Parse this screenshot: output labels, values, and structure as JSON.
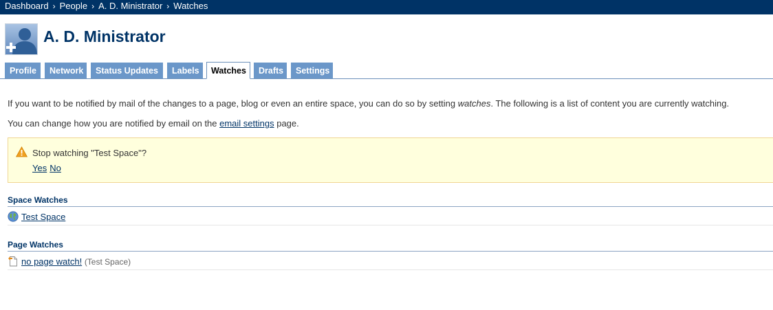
{
  "breadcrumb": {
    "items": [
      "Dashboard",
      "People",
      "A. D. Ministrator",
      "Watches"
    ],
    "separator": "›"
  },
  "header": {
    "title": "A. D. Ministrator",
    "avatar_icon": "user-avatar-icon"
  },
  "tabs": [
    {
      "label": "Profile",
      "active": false
    },
    {
      "label": "Network",
      "active": false
    },
    {
      "label": "Status Updates",
      "active": false
    },
    {
      "label": "Labels",
      "active": false
    },
    {
      "label": "Watches",
      "active": true
    },
    {
      "label": "Drafts",
      "active": false
    },
    {
      "label": "Settings",
      "active": false
    }
  ],
  "intro": {
    "line1_before": "If you want to be notified by mail of the changes to a page, blog or even an entire space, you can do so by setting ",
    "line1_em": "watches",
    "line1_after": ". The following is a list of content you are currently watching.",
    "line2_before": "You can change how you are notified by email on the ",
    "line2_link": "email settings",
    "line2_after": " page."
  },
  "warning": {
    "icon": "warning-icon",
    "message": "Stop watching \"Test Space\"?",
    "yes": "Yes",
    "no": "No"
  },
  "space_watches": {
    "heading": "Space Watches",
    "items": [
      {
        "label": "Test Space",
        "icon": "globe-icon"
      }
    ]
  },
  "page_watches": {
    "heading": "Page Watches",
    "items": [
      {
        "label": "no page watch!",
        "space": "(Test Space)",
        "icon": "page-icon"
      }
    ]
  },
  "colors": {
    "header_bar": "#003366",
    "tab_bg": "#6b97c9",
    "link": "#003366",
    "warning_bg": "#ffffdd",
    "warning_border": "#f0d592"
  }
}
